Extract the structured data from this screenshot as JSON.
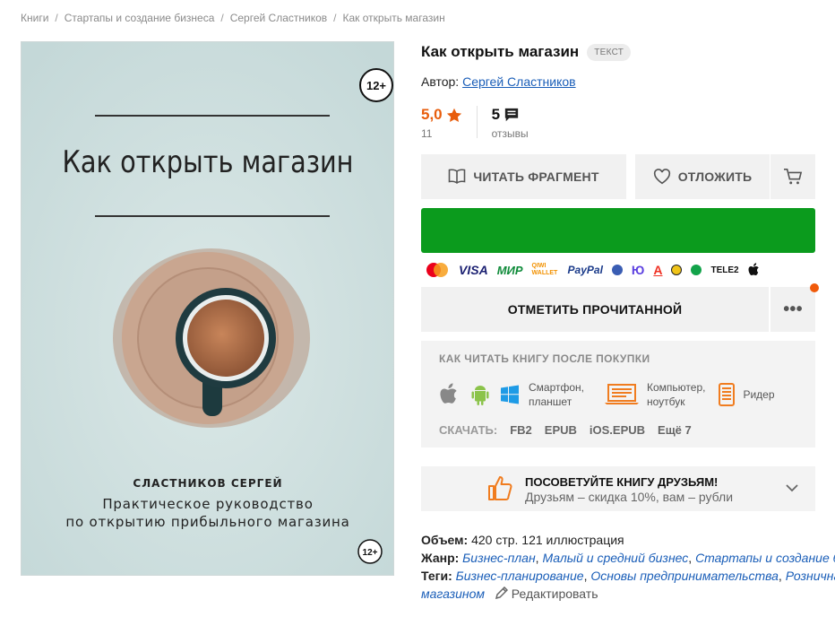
{
  "breadcrumb": [
    "Книги",
    "Стартапы и создание бизнеса",
    "Сергей Сластников",
    "Как открыть магазин"
  ],
  "breadcrumb_sep": "/",
  "cover": {
    "age_badge": "12+",
    "title": "Как открыть магазин",
    "author": "СЛАСТНИКОВ СЕРГЕЙ",
    "subtitle_line1": "Практическое руководство",
    "subtitle_line2": "по открытию прибыльного магазина",
    "colors": {
      "background": "#cfe0e0",
      "saucer": "#c9a690",
      "cup": "#1f3b40",
      "coffee": "#a86a45"
    }
  },
  "book": {
    "title": "Как открыть магазин",
    "type_badge": "ТЕКСТ",
    "author_label": "Автор:",
    "author_name": "Сергей Сластников"
  },
  "rating": {
    "value": "5,0",
    "count": "11",
    "reviews_count": "5",
    "reviews_label": "отзывы"
  },
  "actions": {
    "read_fragment": "ЧИТАТЬ ФРАГМЕНТ",
    "defer": "ОТЛОЖИТЬ",
    "mark_read": "ОТМЕТИТЬ ПРОЧИТАННОЙ",
    "more": "•••",
    "buy_color": "#0b9b1d"
  },
  "payments": {
    "visa": "VISA",
    "mir": "МИР",
    "qiwi": "QIWI WALLET",
    "paypal": "PayPal",
    "ya": "Ю",
    "alfa": "А",
    "tele2": "TELE2"
  },
  "how_to_read": {
    "title": "КАК ЧИТАТЬ КНИГУ ПОСЛЕ ПОКУПКИ",
    "smartphone": "Смартфон,",
    "tablet": "планшет",
    "computer": "Компьютер,",
    "laptop": "ноутбук",
    "reader": "Ридер",
    "download_label": "СКАЧАТЬ:",
    "formats": [
      "FB2",
      "EPUB",
      "iOS.EPUB",
      "Ещё 7"
    ]
  },
  "recommend": {
    "title": "ПОСОВЕТУЙТЕ КНИГУ ДРУЗЬЯМ!",
    "subtitle": "Друзьям – скидка 10%, вам – рубли"
  },
  "meta": {
    "volume_label": "Объем:",
    "volume_value": "420 стр. 121 иллюстрация",
    "genre_label": "Жанр:",
    "genres": [
      "Бизнес-план",
      "Малый и средний бизнес",
      "Стартапы и создание бизнеса"
    ],
    "tags_label": "Теги:",
    "tags": [
      "Бизнес-планирование",
      "Основы предпринимательства",
      "Розничная торговля"
    ],
    "tags_tail": "магазином",
    "edit": "Редактировать"
  },
  "accent_colors": {
    "orange": "#e85d0c",
    "link": "#1a5eb8",
    "notif": "#f05a0a"
  }
}
